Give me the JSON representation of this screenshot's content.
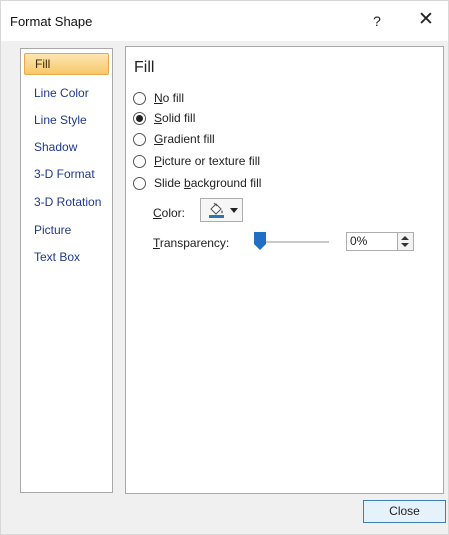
{
  "window": {
    "title": "Format Shape",
    "help_label": "?",
    "close_glyph": "✕"
  },
  "sidebar": {
    "items": [
      {
        "label": "Fill",
        "selected": true
      },
      {
        "label": "Line Color"
      },
      {
        "label": "Line Style"
      },
      {
        "label": "Shadow"
      },
      {
        "label": "3-D Format"
      },
      {
        "label": "3-D Rotation"
      },
      {
        "label": "Picture"
      },
      {
        "label": "Text Box"
      }
    ]
  },
  "fill_panel": {
    "heading": "Fill",
    "options": {
      "no_fill": {
        "mnemonic": "N",
        "rest": "o fill",
        "checked": false
      },
      "solid_fill": {
        "mnemonic": "S",
        "rest": "olid fill",
        "checked": true
      },
      "gradient_fill": {
        "mnemonic": "G",
        "rest": "radient fill",
        "checked": false
      },
      "picture_fill": {
        "mnemonic": "P",
        "rest": "icture or texture fill",
        "checked": false
      },
      "slide_bg_fill": {
        "pre": "Slide ",
        "mnemonic": "b",
        "rest": "ackground fill",
        "checked": false
      }
    },
    "color": {
      "mnemonic": "C",
      "rest": "olor:",
      "icon": "paint-bucket-icon",
      "swatch_color": "#2e75b6"
    },
    "transparency": {
      "mnemonic": "T",
      "rest": "ransparency:",
      "value": "0%",
      "level": 0
    }
  },
  "footer": {
    "close_label": "Close"
  },
  "colors": {
    "accent": "#1f6fc4",
    "selected_item_bg": "#f9d78a",
    "link_text": "#1f3a8a"
  }
}
